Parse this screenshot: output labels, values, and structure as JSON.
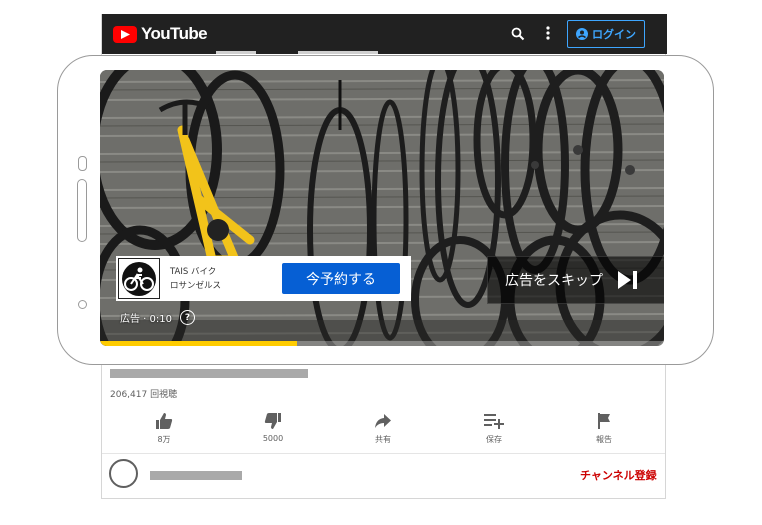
{
  "header": {
    "logo_text": "YouTube",
    "login_label": "ログイン"
  },
  "video": {
    "views": "206,417 回視聴",
    "actions": [
      {
        "icon": "thumbs-up-icon",
        "label": "8万"
      },
      {
        "icon": "thumbs-down-icon",
        "label": "5000"
      },
      {
        "icon": "share-icon",
        "label": "共有"
      },
      {
        "icon": "playlist-add-icon",
        "label": "保存"
      },
      {
        "icon": "flag-icon",
        "label": "報告"
      }
    ],
    "subscribe_label": "チャンネル登録"
  },
  "ad": {
    "advertiser_line1": "TAIS バイク",
    "advertiser_line2": "ロサンゼルス",
    "cta_label": "今予約する",
    "skip_label": "広告をスキップ",
    "time_label": "広告 · 0:10",
    "progress": 0.35
  },
  "colors": {
    "header_bg": "#212121",
    "brand_red": "#ff0000",
    "login_blue": "#3ea6ff",
    "cta_blue": "#065fd4",
    "progress_yellow": "#ffcc00",
    "subscribe_red": "#cc0000"
  }
}
